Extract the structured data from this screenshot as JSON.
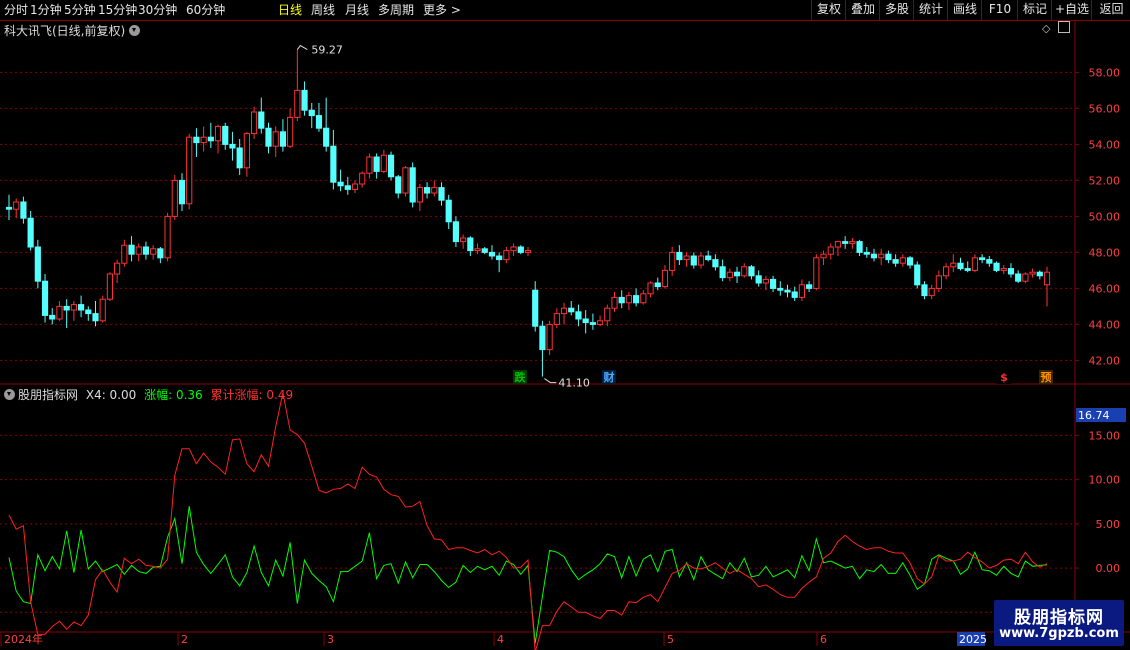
{
  "toolbar": {
    "periods": [
      "分时",
      "1分钟",
      "5分钟",
      "15分钟",
      "30分钟",
      "60分钟",
      "日线",
      "周线",
      "月线",
      "多周期",
      "更多"
    ],
    "active_period": "日线",
    "more_arrow": ">",
    "right_buttons": [
      "复权",
      "叠加",
      "多股",
      "统计",
      "画线",
      "F10",
      "标记",
      "+自选",
      "返回"
    ]
  },
  "main_chart": {
    "title": "科大讯飞(日线,前复权)",
    "diamond_icon": "◇",
    "high_label": "59.27",
    "low_label": "41.10",
    "y_ticks": [
      "58.00",
      "56.00",
      "54.00",
      "52.00",
      "50.00",
      "48.00",
      "46.00",
      "44.00",
      "42.00"
    ],
    "markers": [
      {
        "text": "跌",
        "color": "#00c000"
      },
      {
        "text": "财",
        "color": "#4aa8ff"
      },
      {
        "text": "$",
        "color": "#ff3030"
      },
      {
        "text": "预",
        "color": "#ff9000"
      }
    ],
    "colors": {
      "up": "#ff3232",
      "down": "#54ffff",
      "grid": "#8b0000"
    }
  },
  "indicator": {
    "name": "股朋指标网",
    "x4_label": "X4: 0.00",
    "zhangfu_label": "涨幅: 0.36",
    "leiji_label": "累计涨幅: 0.49",
    "current_value": "16.74",
    "y_ticks": [
      "15.00",
      "10.00",
      "5.00",
      "0.00",
      "-5.00"
    ],
    "colors": {
      "zhangfu": "#00ff00",
      "leiji": "#ff2020"
    }
  },
  "x_axis": {
    "labels": [
      "2024年",
      "2",
      "3",
      "4",
      "5",
      "6"
    ],
    "last_label": "2025"
  },
  "watermark": {
    "line1": "股朋指标网",
    "line2": "www.7gpzb.com"
  },
  "chart_data": {
    "type": "candlestick",
    "title": "科大讯飞(日线,前复权)",
    "ylim": [
      40.8,
      59.8
    ],
    "candles": [
      [
        50.5,
        51.2,
        49.8,
        50.4
      ],
      [
        50.4,
        51.0,
        49.9,
        50.8
      ],
      [
        50.8,
        51.1,
        49.6,
        49.9
      ],
      [
        49.9,
        50.3,
        48.1,
        48.3
      ],
      [
        48.3,
        48.7,
        46.0,
        46.4
      ],
      [
        46.4,
        46.8,
        44.1,
        44.5
      ],
      [
        44.5,
        44.9,
        44.0,
        44.3
      ],
      [
        44.3,
        45.3,
        44.2,
        45.0
      ],
      [
        45.0,
        45.4,
        43.8,
        44.8
      ],
      [
        44.8,
        45.3,
        44.2,
        45.1
      ],
      [
        45.1,
        45.6,
        44.4,
        44.8
      ],
      [
        44.8,
        45.0,
        44.2,
        44.6
      ],
      [
        44.6,
        45.3,
        43.9,
        44.2
      ],
      [
        44.2,
        45.6,
        44.1,
        45.4
      ],
      [
        45.4,
        46.9,
        45.3,
        46.8
      ],
      [
        46.8,
        47.6,
        46.3,
        47.4
      ],
      [
        47.4,
        48.7,
        47.2,
        48.4
      ],
      [
        48.4,
        48.9,
        47.5,
        47.9
      ],
      [
        47.9,
        48.5,
        47.5,
        48.3
      ],
      [
        48.3,
        48.6,
        47.6,
        47.9
      ],
      [
        47.9,
        48.4,
        47.6,
        48.2
      ],
      [
        48.2,
        48.3,
        47.4,
        47.7
      ],
      [
        47.7,
        50.2,
        47.5,
        50.0
      ],
      [
        50.0,
        52.3,
        49.8,
        52.0
      ],
      [
        52.0,
        52.4,
        50.3,
        50.7
      ],
      [
        50.7,
        54.6,
        50.4,
        54.4
      ],
      [
        54.4,
        54.9,
        53.3,
        54.1
      ],
      [
        54.1,
        55.0,
        53.6,
        54.4
      ],
      [
        54.4,
        55.2,
        53.8,
        54.2
      ],
      [
        54.2,
        55.1,
        53.5,
        55.0
      ],
      [
        55.0,
        55.2,
        53.7,
        54.0
      ],
      [
        54.0,
        54.7,
        53.1,
        53.8
      ],
      [
        53.8,
        54.3,
        52.3,
        52.7
      ],
      [
        52.7,
        54.7,
        52.2,
        54.6
      ],
      [
        54.6,
        56.1,
        54.3,
        55.8
      ],
      [
        55.8,
        56.6,
        54.6,
        54.9
      ],
      [
        54.9,
        55.2,
        53.5,
        53.9
      ],
      [
        53.9,
        55.0,
        53.3,
        54.7
      ],
      [
        54.7,
        55.4,
        53.6,
        53.9
      ],
      [
        53.9,
        56.0,
        53.8,
        55.5
      ],
      [
        55.5,
        59.27,
        55.3,
        57.0
      ],
      [
        57.0,
        57.5,
        55.6,
        55.9
      ],
      [
        55.9,
        56.3,
        54.9,
        55.6
      ],
      [
        55.6,
        56.3,
        54.7,
        54.9
      ],
      [
        54.9,
        56.6,
        53.6,
        53.9
      ],
      [
        53.9,
        54.8,
        51.5,
        51.9
      ],
      [
        51.9,
        52.6,
        51.4,
        51.7
      ],
      [
        51.7,
        52.2,
        51.2,
        51.5
      ],
      [
        51.5,
        52.0,
        51.3,
        51.8
      ],
      [
        51.8,
        52.5,
        51.6,
        52.4
      ],
      [
        52.4,
        53.5,
        52.1,
        53.3
      ],
      [
        53.3,
        53.5,
        52.1,
        52.5
      ],
      [
        52.5,
        53.7,
        52.4,
        53.4
      ],
      [
        53.4,
        53.6,
        52.0,
        52.2
      ],
      [
        52.2,
        52.3,
        51.0,
        51.3
      ],
      [
        51.3,
        52.8,
        51.1,
        52.7
      ],
      [
        52.7,
        53.0,
        50.5,
        50.8
      ],
      [
        50.8,
        51.8,
        50.3,
        51.6
      ],
      [
        51.6,
        51.9,
        51.0,
        51.3
      ],
      [
        51.3,
        52.0,
        51.1,
        51.6
      ],
      [
        51.6,
        51.9,
        50.6,
        50.9
      ],
      [
        50.9,
        51.2,
        49.3,
        49.7
      ],
      [
        49.7,
        50.0,
        48.3,
        48.6
      ],
      [
        48.6,
        49.0,
        48.2,
        48.8
      ],
      [
        48.8,
        48.9,
        47.8,
        48.1
      ],
      [
        48.1,
        48.5,
        47.9,
        48.2
      ],
      [
        48.2,
        48.3,
        47.9,
        48.0
      ],
      [
        48.0,
        48.4,
        47.6,
        47.8
      ],
      [
        47.8,
        48.0,
        46.9,
        47.6
      ],
      [
        47.6,
        48.3,
        47.4,
        48.1
      ],
      [
        48.1,
        48.5,
        47.8,
        48.3
      ],
      [
        48.3,
        48.4,
        47.9,
        48.0
      ],
      [
        48.0,
        48.3,
        47.8,
        48.1
      ],
      [
        45.9,
        46.4,
        43.6,
        43.9
      ],
      [
        43.9,
        44.2,
        41.1,
        42.6
      ],
      [
        42.6,
        44.2,
        42.3,
        44.0
      ],
      [
        44.0,
        44.9,
        43.8,
        44.6
      ],
      [
        44.6,
        45.2,
        44.0,
        44.9
      ],
      [
        44.9,
        45.3,
        44.5,
        44.7
      ],
      [
        44.7,
        45.1,
        43.9,
        44.3
      ],
      [
        44.3,
        44.8,
        43.5,
        44.1
      ],
      [
        44.1,
        44.6,
        43.7,
        44.0
      ],
      [
        44.0,
        44.5,
        43.9,
        44.2
      ],
      [
        44.2,
        45.1,
        43.9,
        44.9
      ],
      [
        44.9,
        45.8,
        44.7,
        45.5
      ],
      [
        45.5,
        45.9,
        44.9,
        45.2
      ],
      [
        45.2,
        45.8,
        44.8,
        45.6
      ],
      [
        45.6,
        46.0,
        45.0,
        45.2
      ],
      [
        45.2,
        45.9,
        45.1,
        45.7
      ],
      [
        45.7,
        46.4,
        45.5,
        46.3
      ],
      [
        46.3,
        46.6,
        45.9,
        46.1
      ],
      [
        46.1,
        47.3,
        46.0,
        47.0
      ],
      [
        47.0,
        48.3,
        46.7,
        48.0
      ],
      [
        48.0,
        48.4,
        47.3,
        47.6
      ],
      [
        47.6,
        48.0,
        47.2,
        47.8
      ],
      [
        47.8,
        48.0,
        47.1,
        47.3
      ],
      [
        47.3,
        48.0,
        47.1,
        47.8
      ],
      [
        47.8,
        48.1,
        47.5,
        47.6
      ],
      [
        47.6,
        47.9,
        47.0,
        47.2
      ],
      [
        47.2,
        47.6,
        46.4,
        46.6
      ],
      [
        46.6,
        47.1,
        46.4,
        46.9
      ],
      [
        46.9,
        47.2,
        46.3,
        46.7
      ],
      [
        46.7,
        47.4,
        46.6,
        47.2
      ],
      [
        47.2,
        47.3,
        46.5,
        46.7
      ],
      [
        46.7,
        47.0,
        46.1,
        46.3
      ],
      [
        46.3,
        46.7,
        45.9,
        46.5
      ],
      [
        46.5,
        46.7,
        45.8,
        46.0
      ],
      [
        46.0,
        46.4,
        45.6,
        45.9
      ],
      [
        45.9,
        46.2,
        45.5,
        45.8
      ],
      [
        45.8,
        46.1,
        45.3,
        45.5
      ],
      [
        45.5,
        46.5,
        45.3,
        46.2
      ],
      [
        46.2,
        46.4,
        45.8,
        46.0
      ],
      [
        46.0,
        47.9,
        45.9,
        47.7
      ],
      [
        47.7,
        48.1,
        47.3,
        47.9
      ],
      [
        47.9,
        48.5,
        47.6,
        48.3
      ],
      [
        48.3,
        48.6,
        47.8,
        48.6
      ],
      [
        48.6,
        48.9,
        48.2,
        48.5
      ],
      [
        48.5,
        48.8,
        48.2,
        48.6
      ],
      [
        48.6,
        48.7,
        47.8,
        48.0
      ],
      [
        48.0,
        48.3,
        47.7,
        47.9
      ],
      [
        47.9,
        48.2,
        47.5,
        47.7
      ],
      [
        47.7,
        48.2,
        47.3,
        47.9
      ],
      [
        47.9,
        48.1,
        47.4,
        47.6
      ],
      [
        47.6,
        47.9,
        47.2,
        47.4
      ],
      [
        47.4,
        47.9,
        47.2,
        47.7
      ],
      [
        47.7,
        47.8,
        47.1,
        47.3
      ],
      [
        47.3,
        47.5,
        46.0,
        46.2
      ],
      [
        46.2,
        46.4,
        45.4,
        45.6
      ],
      [
        45.6,
        46.2,
        45.4,
        46.0
      ],
      [
        46.0,
        47.0,
        45.8,
        46.7
      ],
      [
        46.7,
        47.4,
        46.5,
        47.2
      ],
      [
        47.2,
        47.9,
        46.9,
        47.4
      ],
      [
        47.4,
        47.7,
        47.0,
        47.1
      ],
      [
        47.1,
        47.5,
        46.9,
        47.0
      ],
      [
        47.0,
        47.9,
        46.9,
        47.7
      ],
      [
        47.7,
        47.9,
        47.4,
        47.6
      ],
      [
        47.6,
        47.8,
        47.2,
        47.4
      ],
      [
        47.4,
        47.5,
        46.9,
        47.0
      ],
      [
        47.0,
        47.3,
        46.8,
        47.1
      ],
      [
        47.1,
        47.4,
        46.6,
        46.8
      ],
      [
        46.8,
        47.0,
        46.3,
        46.4
      ],
      [
        46.4,
        46.9,
        46.3,
        46.8
      ],
      [
        46.8,
        47.1,
        46.6,
        46.9
      ],
      [
        46.9,
        47.0,
        46.5,
        46.7
      ],
      [
        46.2,
        47.2,
        45.0,
        46.9
      ]
    ],
    "series": [
      {
        "name": "涨幅",
        "color": "#00ff00",
        "values": [
          1.2,
          -2.6,
          -3.8,
          -4.0,
          1.5,
          -0.3,
          1.3,
          -0.1,
          4.2,
          -0.5,
          4.3,
          -0.1,
          0.8,
          -0.4,
          0.0,
          0.4,
          -0.7,
          0.3,
          -0.4,
          -0.6,
          0.1,
          0.2,
          3.5,
          5.6,
          0.5,
          7.0,
          1.8,
          0.4,
          -0.6,
          0.4,
          1.5,
          -1.0,
          -2.0,
          -0.5,
          2.5,
          -0.5,
          -2.0,
          0.9,
          -0.9,
          2.9,
          -4.0,
          0.9,
          -0.6,
          -1.4,
          -2.1,
          -3.8,
          -0.4,
          -0.4,
          0.2,
          0.8,
          4.0,
          -1.2,
          0.3,
          0.5,
          -1.7,
          0.7,
          -1.1,
          0.4,
          0.4,
          -0.4,
          -1.4,
          -2.2,
          -1.6,
          0.3,
          -0.5,
          0.2,
          -0.2,
          0.2,
          -0.8,
          0.8,
          0.4,
          -0.7,
          0.3,
          -8.5,
          -3.2,
          2.0,
          1.8,
          1.3,
          -0.2,
          -1.3,
          -0.7,
          -0.2,
          0.5,
          1.6,
          1.3,
          -1.1,
          1.3,
          -0.9,
          1.0,
          1.5,
          -0.4,
          1.9,
          2.1,
          -1.0,
          0.6,
          -1.3,
          1.3,
          -0.2,
          -0.7,
          -1.2,
          0.6,
          -0.4,
          1.1,
          -1.0,
          -0.8,
          0.2,
          -1.0,
          -0.6,
          -0.2,
          -1.1,
          1.4,
          -0.3,
          3.3,
          0.6,
          0.8,
          0.4,
          0.0,
          0.2,
          -1.2,
          -0.2,
          -0.4,
          0.4,
          -0.6,
          -0.6,
          0.6,
          -0.8,
          -2.4,
          -1.8,
          1.0,
          1.5,
          1.1,
          0.8,
          -0.7,
          -0.1,
          1.8,
          -0.2,
          -0.3,
          -0.8,
          0.2,
          -0.6,
          -1.0,
          0.8,
          0.2,
          0.3,
          0.36
        ]
      },
      {
        "name": "累计涨幅",
        "color": "#ff2020",
        "values": [
          6.0,
          4.4,
          4.8,
          -3.8,
          -7.5,
          -7.5,
          -6.6,
          -6.0,
          -6.9,
          -6.1,
          -6.5,
          -5.3,
          -1.3,
          -0.2,
          -1.6,
          -2.7,
          1.1,
          0.5,
          1.0,
          0.3,
          0.2,
          0.0,
          1.0,
          10.5,
          13.5,
          13.5,
          11.8,
          13.0,
          12.0,
          11.4,
          10.6,
          14.5,
          14.6,
          11.8,
          10.9,
          12.8,
          11.5,
          16.0,
          19.8,
          15.6,
          15.1,
          14.1,
          11.5,
          8.8,
          8.5,
          8.9,
          9.0,
          9.5,
          9.0,
          11.4,
          10.6,
          10.3,
          8.9,
          8.3,
          8.1,
          6.9,
          7.0,
          7.5,
          4.8,
          3.3,
          3.2,
          2.1,
          2.3,
          2.3,
          2.0,
          1.7,
          2.1,
          1.5,
          1.9,
          1.2,
          0.0,
          0.1,
          0.9,
          -9.5,
          -6.5,
          -6.5,
          -4.9,
          -3.8,
          -4.4,
          -5.0,
          -5.0,
          -5.4,
          -5.7,
          -4.8,
          -4.8,
          -5.3,
          -3.8,
          -3.9,
          -3.3,
          -3.0,
          -3.8,
          -2.2,
          -0.6,
          -0.3,
          0.5,
          0.0,
          -0.1,
          0.2,
          0.6,
          0.0,
          -0.6,
          -0.2,
          -0.7,
          -1.2,
          -2.1,
          -1.9,
          -2.4,
          -3.0,
          -3.3,
          -3.3,
          -2.3,
          -1.6,
          -1.0,
          1.1,
          1.7,
          3.0,
          3.7,
          3.0,
          2.5,
          2.1,
          2.3,
          2.3,
          1.9,
          1.7,
          1.7,
          0.6,
          -1.2,
          -1.8,
          -1.0,
          1.4,
          0.8,
          0.8,
          1.0,
          1.8,
          1.2,
          0.7,
          0.0,
          0.3,
          0.9,
          1.0,
          0.5,
          1.8,
          0.7,
          0.1,
          0.49
        ]
      }
    ],
    "indicator_ylim": [
      -7,
      19
    ]
  }
}
